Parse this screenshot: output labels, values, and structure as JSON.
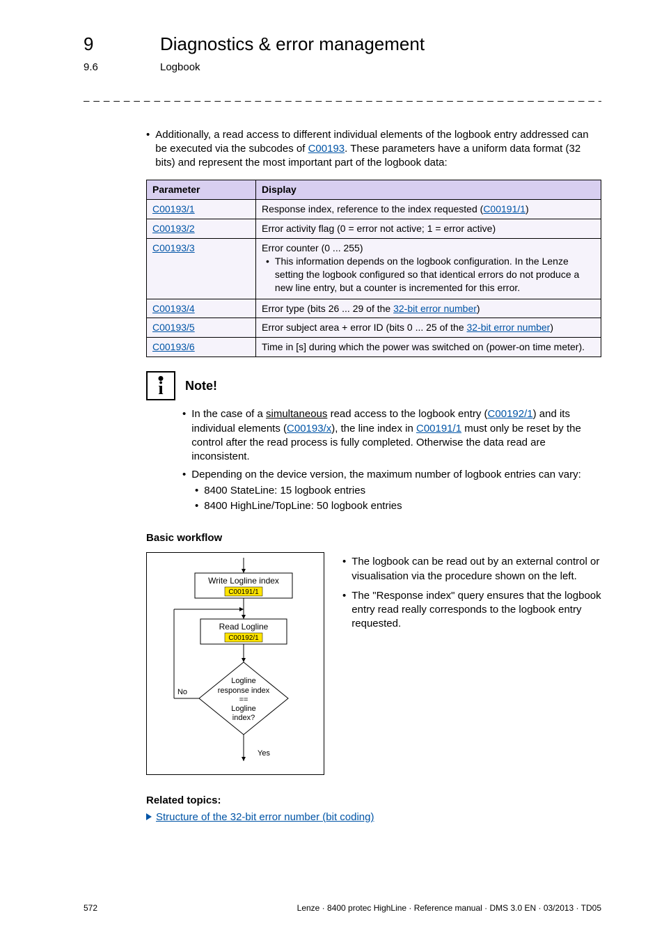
{
  "header": {
    "chapter_num": "9",
    "chapter_title": "Diagnostics & error management",
    "section_num": "9.6",
    "section_title": "Logbook"
  },
  "intro": {
    "b1_seg1": "Additionally, a read access to different individual elements of the logbook entry addressed can be executed via the subcodes of ",
    "b1_link": "C00193",
    "b1_seg2": ". These parameters have a uniform data format (32 bits) and represent the most important part of the logbook data:"
  },
  "table": {
    "h_param": "Parameter",
    "h_display": "Display",
    "rows": [
      {
        "param": "C00193/1",
        "disp_pre": "Response index, reference to the index requested (",
        "disp_link": "C00191/1",
        "disp_post": ")"
      },
      {
        "param": "C00193/2",
        "disp_pre": "Error activity flag (0 = error not active; 1 = error active)",
        "disp_link": "",
        "disp_post": ""
      },
      {
        "param": "C00193/3",
        "disp_pre": "Error counter (0 ... 255)",
        "sub_bullet": "This information depends on the logbook configuration. In the Lenze setting the logbook configured so that identical errors do not produce a new line entry, but a counter is incremented for this error.",
        "disp_link": "",
        "disp_post": ""
      },
      {
        "param": "C00193/4",
        "disp_pre": "Error type (bits 26 ... 29 of the ",
        "disp_link": "32-bit error number",
        "disp_post": ")"
      },
      {
        "param": "C00193/5",
        "disp_pre": "Error subject area + error ID (bits 0 ... 25 of the ",
        "disp_link": "32-bit error number",
        "disp_post": ")"
      },
      {
        "param": "C00193/6",
        "disp_pre": "Time in [s] during which the power was switched on (power-on time meter).",
        "disp_link": "",
        "disp_post": ""
      }
    ]
  },
  "note": {
    "label": "Note!",
    "b1_s1": "In the case of a ",
    "b1_u": "simultaneous",
    "b1_s2": " read access to the logbook entry (",
    "b1_l1": "C00192/1",
    "b1_s3": ") and its individual elements (",
    "b1_l2": "C00193/x",
    "b1_s4": "), the line index in ",
    "b1_l3": "C00191/1",
    "b1_s5": " must only be reset by the control after the read process is fully completed. Otherwise the data read are inconsistent.",
    "b2": "Depending on the device version, the maximum number of logbook entries can vary:",
    "b2a": "8400 StateLine: 15 logbook entries",
    "b2b": "8400 HighLine/TopLine: 50 logbook entries"
  },
  "workflow": {
    "heading": "Basic workflow",
    "box1_line1": "Write Logline index",
    "box1_line2": "C00191/1",
    "box2_line1": "Read Logline",
    "box2_line2": "C00192/1",
    "diamond_l1": "Logline",
    "diamond_l2": "response index",
    "diamond_l3": "==",
    "diamond_l4": "Logline",
    "diamond_l5": "index?",
    "no": "No",
    "yes": "Yes",
    "rt_b1": "The logbook can be read out by an external control or visualisation via the procedure shown on the left.",
    "rt_b2": "The \"Response index\" query ensures that the logbook entry read really corresponds to the logbook entry requested."
  },
  "related": {
    "heading": "Related topics:",
    "item": "Structure of the 32-bit error number (bit coding)"
  },
  "footer": {
    "page": "572",
    "right": "Lenze · 8400 protec HighLine · Reference manual · DMS 3.0 EN · 03/2013 · TD05"
  },
  "chart_data": {
    "type": "flowchart",
    "nodes": [
      {
        "id": "n1",
        "kind": "process",
        "label": "Write Logline index C00191/1"
      },
      {
        "id": "n2",
        "kind": "process",
        "label": "Read Logline C00192/1"
      },
      {
        "id": "n3",
        "kind": "decision",
        "label": "Logline response index == Logline index?"
      }
    ],
    "edges": [
      {
        "from": "start",
        "to": "n1"
      },
      {
        "from": "n1",
        "to": "n2"
      },
      {
        "from": "n2",
        "to": "n3"
      },
      {
        "from": "n3",
        "to": "n2",
        "label": "No"
      },
      {
        "from": "n3",
        "to": "end",
        "label": "Yes"
      }
    ]
  }
}
